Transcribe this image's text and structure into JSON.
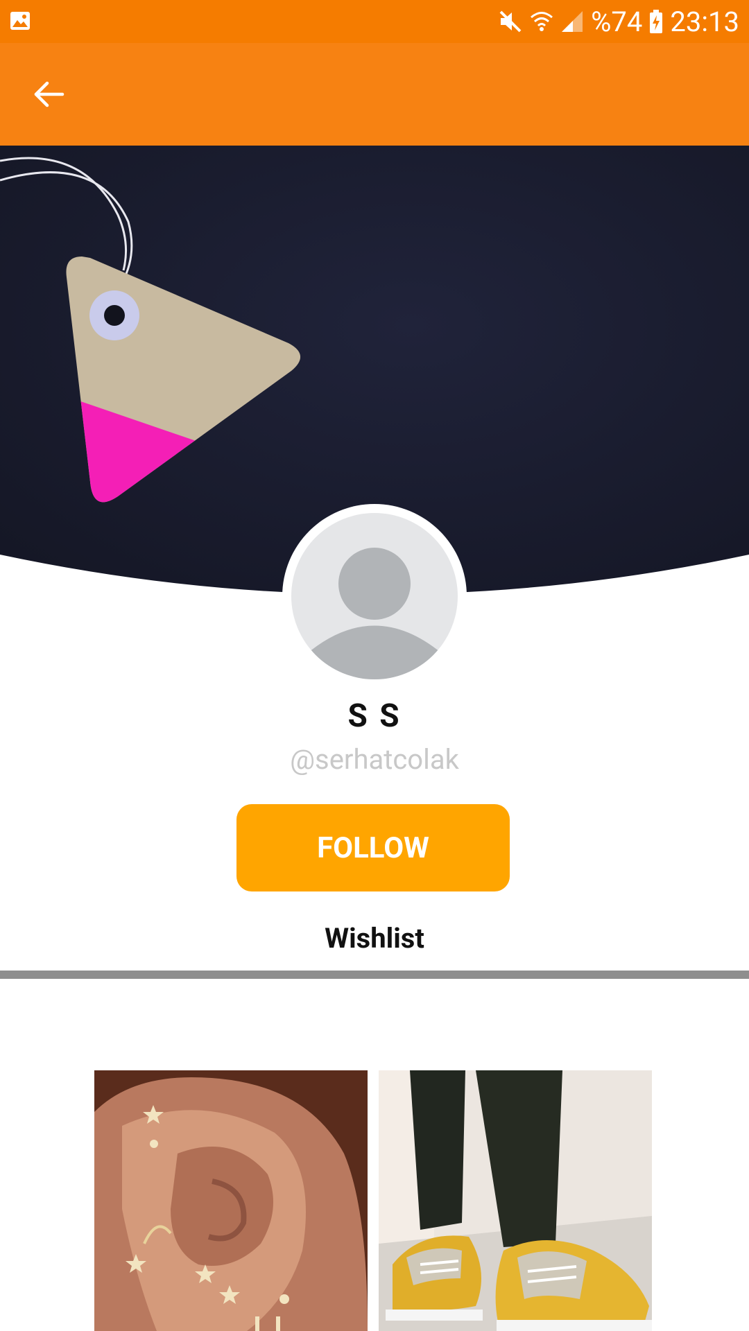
{
  "status_bar": {
    "battery": "%74",
    "time": "23:13",
    "icons": [
      "gallery-icon",
      "mute-icon",
      "wifi-icon",
      "signal-icon",
      "battery-charging-icon"
    ]
  },
  "app_bar": {
    "back_icon": "arrow-left-icon",
    "color": "#f78212"
  },
  "profile": {
    "display_name": "S S",
    "username": "@serhatcolak",
    "follow_label": "FOLLOW",
    "follow_color": "#ffa500"
  },
  "tabs": {
    "active": "Wishlist"
  },
  "wishlist_items": [
    {
      "name": "ear-cuff-earrings-image"
    },
    {
      "name": "yellow-sneakers-image"
    }
  ]
}
